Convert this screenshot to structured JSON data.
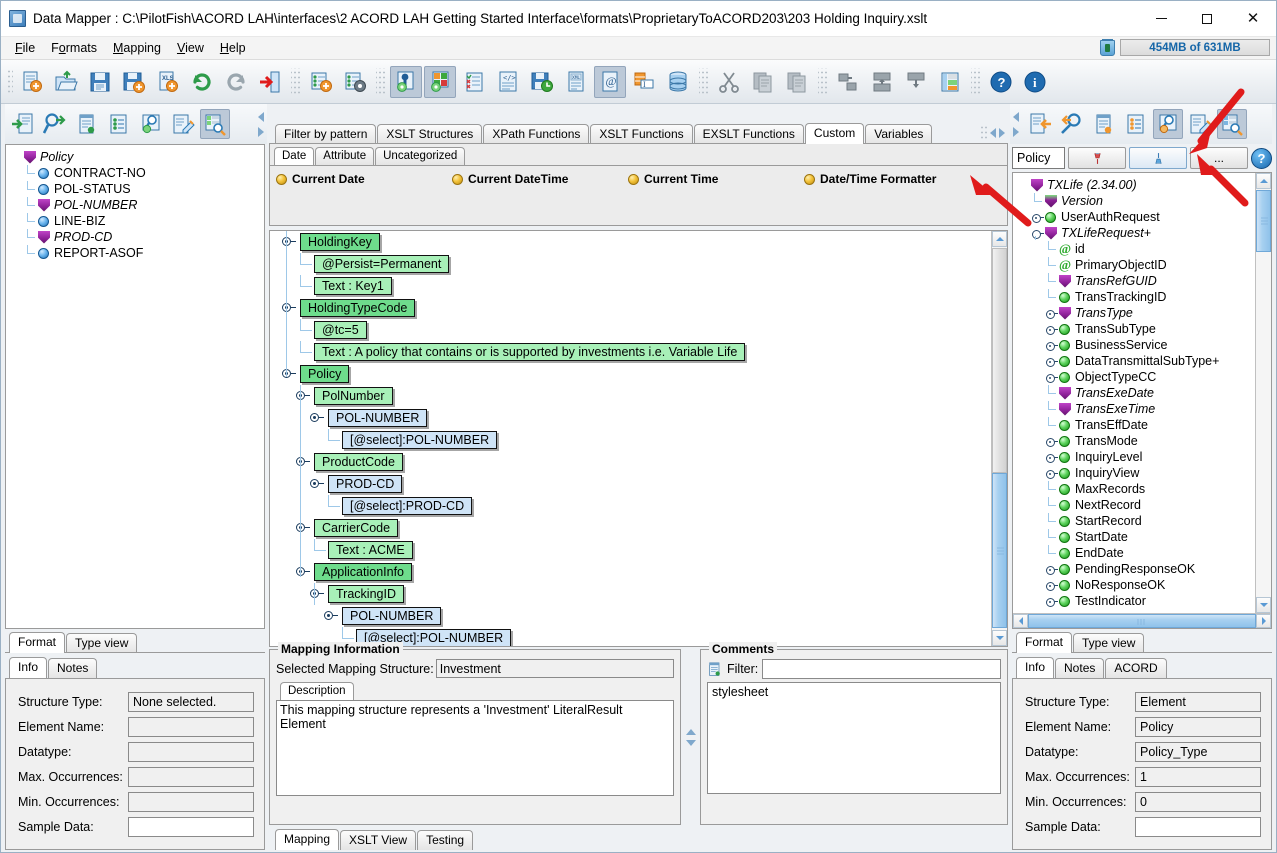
{
  "window": {
    "title": "Data Mapper : C:\\PilotFish\\ACORD LAH\\interfaces\\2 ACORD LAH Getting Started Interface\\formats\\ProprietaryToACORD203\\203 Holding Inquiry.xslt",
    "minimize": "–",
    "maximize": "□",
    "close": "✕"
  },
  "menu": {
    "items": [
      "File",
      "Formats",
      "Mapping",
      "View",
      "Help"
    ],
    "memory": "454MB of 631MB"
  },
  "toolbar": {
    "groups": [
      {
        "buttons": [
          {
            "name": "new-mapping-icon",
            "label": "New"
          },
          {
            "name": "open-folder-icon",
            "label": "Open"
          },
          {
            "name": "save-icon",
            "label": "Save"
          },
          {
            "name": "save-as-icon",
            "label": "Save As"
          },
          {
            "name": "export-xls-icon",
            "label": "Export XLS"
          },
          {
            "name": "undo-icon",
            "label": "Undo"
          },
          {
            "name": "redo-icon",
            "label": "Redo"
          },
          {
            "name": "exit-icon",
            "label": "Exit"
          }
        ]
      },
      {
        "buttons": [
          {
            "name": "add-format-icon",
            "label": "Add Format"
          },
          {
            "name": "format-settings-icon",
            "label": "Format Settings"
          }
        ]
      },
      {
        "buttons": [
          {
            "name": "show-info-icon",
            "label": "Show Info",
            "active": true
          },
          {
            "name": "show-colors-icon",
            "label": "Show Colors",
            "active": true
          },
          {
            "name": "validate-icon",
            "label": "Validate"
          },
          {
            "name": "source-view-icon",
            "label": "Source View"
          },
          {
            "name": "save-test-icon",
            "label": "Save Test"
          },
          {
            "name": "xml-doc-icon",
            "label": "XML Document"
          },
          {
            "name": "at-doc-icon",
            "label": "Annotations",
            "active": true
          },
          {
            "name": "table-insert-icon",
            "label": "Insert Table"
          },
          {
            "name": "database-icon",
            "label": "Database"
          }
        ]
      },
      {
        "buttons": [
          {
            "name": "cut-icon",
            "label": "Cut"
          },
          {
            "name": "copy-icon",
            "label": "Copy"
          },
          {
            "name": "paste-icon",
            "label": "Paste"
          }
        ]
      },
      {
        "buttons": [
          {
            "name": "move-left-icon",
            "label": "Move Left"
          },
          {
            "name": "move-up-icon",
            "label": "Move Up"
          },
          {
            "name": "move-down-icon",
            "label": "Move Down"
          },
          {
            "name": "group-icon",
            "label": "Group"
          }
        ]
      },
      {
        "buttons": [
          {
            "name": "help-icon",
            "label": "Help"
          },
          {
            "name": "about-icon",
            "label": "About"
          }
        ]
      }
    ]
  },
  "left_toolbar": {
    "buttons": [
      {
        "name": "import-source-icon",
        "label": "Import Source"
      },
      {
        "name": "find-source-icon",
        "label": "Find Source"
      },
      {
        "name": "notes-source-icon",
        "label": "Source Notes"
      },
      {
        "name": "list-source-icon",
        "label": "Source List"
      },
      {
        "name": "inspect-source-icon",
        "label": "Inspect Source"
      },
      {
        "name": "edit-source-icon",
        "label": "Edit Source"
      },
      {
        "name": "tree-source-icon",
        "label": "Source Tree View",
        "active": true
      }
    ]
  },
  "right_toolbar": {
    "buttons": [
      {
        "name": "import-target-icon",
        "label": "Import Target"
      },
      {
        "name": "find-target-icon",
        "label": "Find Target"
      },
      {
        "name": "notes-target-icon",
        "label": "Target Notes"
      },
      {
        "name": "list-target-icon",
        "label": "Target List"
      },
      {
        "name": "inspect-target-icon",
        "label": "Inspect Target",
        "active": true
      },
      {
        "name": "edit-target-icon",
        "label": "Edit Target"
      },
      {
        "name": "tree-target-icon",
        "label": "Target Tree View",
        "active": true
      }
    ]
  },
  "left_panel": {
    "tree": [
      {
        "label": "Policy",
        "icon": "shield",
        "indent": 0,
        "handle": "root",
        "italic": true
      },
      {
        "label": "CONTRACT-NO",
        "icon": "ball",
        "indent": 1,
        "handle": "leaf",
        "italic": false
      },
      {
        "label": "POL-STATUS",
        "icon": "ball",
        "indent": 1,
        "handle": "leaf",
        "italic": false
      },
      {
        "label": "POL-NUMBER",
        "icon": "shield",
        "indent": 1,
        "handle": "leaf",
        "italic": true
      },
      {
        "label": "LINE-BIZ",
        "icon": "ball",
        "indent": 1,
        "handle": "leaf",
        "italic": false
      },
      {
        "label": "PROD-CD",
        "icon": "shield",
        "indent": 1,
        "handle": "leaf",
        "italic": true
      },
      {
        "label": "REPORT-ASOF",
        "icon": "ball",
        "indent": 1,
        "handle": "leaf-last",
        "italic": false
      }
    ],
    "view_tabs": [
      {
        "label": "Format",
        "selected": true
      },
      {
        "label": "Type view",
        "selected": false
      }
    ],
    "detail_tabs": [
      {
        "label": "Info",
        "selected": true
      },
      {
        "label": "Notes",
        "selected": false
      }
    ],
    "info": [
      {
        "label": "Structure Type:",
        "value": "None selected.",
        "white": false
      },
      {
        "label": "Element Name:",
        "value": "",
        "white": false
      },
      {
        "label": "Datatype:",
        "value": "",
        "white": false
      },
      {
        "label": "Max. Occurrences:",
        "value": "",
        "white": false
      },
      {
        "label": "Min. Occurrences:",
        "value": "",
        "white": false
      },
      {
        "label": "Sample Data:",
        "value": "",
        "white": true
      }
    ]
  },
  "center_panel": {
    "func_tabs": [
      {
        "label": "Filter by pattern",
        "selected": false
      },
      {
        "label": "XSLT Structures",
        "selected": false
      },
      {
        "label": "XPath Functions",
        "selected": false
      },
      {
        "label": "XSLT Functions",
        "selected": false
      },
      {
        "label": "EXSLT Functions",
        "selected": false
      },
      {
        "label": "Custom",
        "selected": true
      },
      {
        "label": "Variables",
        "selected": false
      }
    ],
    "func_subtabs": [
      {
        "label": "Date",
        "selected": true
      },
      {
        "label": "Attribute",
        "selected": false
      },
      {
        "label": "Uncategorized",
        "selected": false
      }
    ],
    "func_items": [
      "Current Date",
      "Current DateTime",
      "Current Time",
      "Date/Time Formatter"
    ],
    "mapping_tree": [
      {
        "label": "HoldingKey",
        "type": "g1",
        "indent": 0,
        "knob": true
      },
      {
        "label": "@Persist=Permanent",
        "type": "g2",
        "indent": 1,
        "knob": false
      },
      {
        "label": "Text : Key1",
        "type": "g2",
        "indent": 1,
        "knob": false
      },
      {
        "label": "HoldingTypeCode",
        "type": "g1",
        "indent": 0,
        "knob": true
      },
      {
        "label": "@tc=5",
        "type": "g2",
        "indent": 1,
        "knob": false
      },
      {
        "label": "Text : A policy that contains or is supported by investments i.e. Variable Life",
        "type": "g2",
        "indent": 1,
        "knob": false
      },
      {
        "label": "Policy",
        "type": "g1",
        "indent": 0,
        "knob": true
      },
      {
        "label": "PolNumber",
        "type": "g2",
        "indent": 1,
        "knob": true
      },
      {
        "label": "POL-NUMBER",
        "type": "b1",
        "indent": 2,
        "knob": true
      },
      {
        "label": "[@select]:POL-NUMBER",
        "type": "b1",
        "indent": 3,
        "knob": false
      },
      {
        "label": "ProductCode",
        "type": "g2",
        "indent": 1,
        "knob": true
      },
      {
        "label": "PROD-CD",
        "type": "b1",
        "indent": 2,
        "knob": true
      },
      {
        "label": "[@select]:PROD-CD",
        "type": "b1",
        "indent": 3,
        "knob": false
      },
      {
        "label": "CarrierCode",
        "type": "g2",
        "indent": 1,
        "knob": true
      },
      {
        "label": "Text : ACME",
        "type": "g2",
        "indent": 2,
        "knob": false
      },
      {
        "label": "ApplicationInfo",
        "type": "g1",
        "indent": 1,
        "knob": true
      },
      {
        "label": "TrackingID",
        "type": "g2",
        "indent": 2,
        "knob": true
      },
      {
        "label": "POL-NUMBER",
        "type": "b1",
        "indent": 3,
        "knob": true
      },
      {
        "label": "[@select]:POL-NUMBER",
        "type": "b1",
        "indent": 4,
        "knob": false
      }
    ],
    "mapping_info": {
      "group_title": "Mapping Information",
      "selected_label": "Selected Mapping Structure:",
      "selected_value": "Investment",
      "desc_tab": "Description",
      "description": "This mapping structure represents a 'Investment' LiteralResult Element"
    },
    "comments": {
      "group_title": "Comments",
      "filter_label": "Filter:",
      "filter_value": "",
      "body": "stylesheet"
    },
    "bottom_tabs": [
      {
        "label": "Mapping",
        "selected": true
      },
      {
        "label": "XSLT View",
        "selected": false
      },
      {
        "label": "Testing",
        "selected": false
      }
    ]
  },
  "right_panel": {
    "search_value": "Policy",
    "btn_prev": "pin-red-icon",
    "btn_next": "pin-blue-icon",
    "btn_more": "...",
    "btn_help": "?",
    "tree": [
      {
        "label": "TXLife (2.34.00)",
        "icon": "shield",
        "indent": 0,
        "handle": "root",
        "italic": true
      },
      {
        "label": "Version",
        "icon": "shield-green",
        "indent": 1,
        "handle": "leaf",
        "italic": true
      },
      {
        "label": "UserAuthRequest",
        "icon": "ball-green",
        "indent": 1,
        "handle": "plus",
        "italic": false
      },
      {
        "label": "TXLifeRequest+",
        "icon": "shield",
        "indent": 1,
        "handle": "minus",
        "italic": true
      },
      {
        "label": "id",
        "icon": "at",
        "indent": 2,
        "handle": "leaf",
        "italic": false
      },
      {
        "label": "PrimaryObjectID",
        "icon": "at",
        "indent": 2,
        "handle": "leaf",
        "italic": false
      },
      {
        "label": "TransRefGUID",
        "icon": "shield",
        "indent": 2,
        "handle": "leaf",
        "italic": true
      },
      {
        "label": "TransTrackingID",
        "icon": "ball-green",
        "indent": 2,
        "handle": "leaf",
        "italic": false
      },
      {
        "label": "TransType",
        "icon": "shield",
        "indent": 2,
        "handle": "plus",
        "italic": true
      },
      {
        "label": "TransSubType",
        "icon": "ball-green",
        "indent": 2,
        "handle": "plus",
        "italic": false
      },
      {
        "label": "BusinessService",
        "icon": "ball-green",
        "indent": 2,
        "handle": "plus",
        "italic": false
      },
      {
        "label": "DataTransmittalSubType+",
        "icon": "ball-green",
        "indent": 2,
        "handle": "plus",
        "italic": false
      },
      {
        "label": "ObjectTypeCC",
        "icon": "ball-green",
        "indent": 2,
        "handle": "plus",
        "italic": false
      },
      {
        "label": "TransExeDate",
        "icon": "shield",
        "indent": 2,
        "handle": "leaf",
        "italic": true
      },
      {
        "label": "TransExeTime",
        "icon": "shield",
        "indent": 2,
        "handle": "leaf",
        "italic": true
      },
      {
        "label": "TransEffDate",
        "icon": "ball-green",
        "indent": 2,
        "handle": "leaf",
        "italic": false
      },
      {
        "label": "TransMode",
        "icon": "ball-green",
        "indent": 2,
        "handle": "plus",
        "italic": false
      },
      {
        "label": "InquiryLevel",
        "icon": "ball-green",
        "indent": 2,
        "handle": "plus",
        "italic": false
      },
      {
        "label": "InquiryView",
        "icon": "ball-green",
        "indent": 2,
        "handle": "plus",
        "italic": false
      },
      {
        "label": "MaxRecords",
        "icon": "ball-green",
        "indent": 2,
        "handle": "leaf",
        "italic": false
      },
      {
        "label": "NextRecord",
        "icon": "ball-green",
        "indent": 2,
        "handle": "leaf",
        "italic": false
      },
      {
        "label": "StartRecord",
        "icon": "ball-green",
        "indent": 2,
        "handle": "leaf",
        "italic": false
      },
      {
        "label": "StartDate",
        "icon": "ball-green",
        "indent": 2,
        "handle": "leaf",
        "italic": false
      },
      {
        "label": "EndDate",
        "icon": "ball-green",
        "indent": 2,
        "handle": "leaf",
        "italic": false
      },
      {
        "label": "PendingResponseOK",
        "icon": "ball-green",
        "indent": 2,
        "handle": "plus",
        "italic": false
      },
      {
        "label": "NoResponseOK",
        "icon": "ball-green",
        "indent": 2,
        "handle": "plus",
        "italic": false
      },
      {
        "label": "TestIndicator",
        "icon": "ball-green",
        "indent": 2,
        "handle": "plus",
        "italic": false
      }
    ],
    "view_tabs": [
      {
        "label": "Format",
        "selected": true
      },
      {
        "label": "Type view",
        "selected": false
      }
    ],
    "detail_tabs": [
      {
        "label": "Info",
        "selected": true
      },
      {
        "label": "Notes",
        "selected": false
      },
      {
        "label": "ACORD",
        "selected": false
      }
    ],
    "info": [
      {
        "label": "Structure Type:",
        "value": "Element",
        "white": false
      },
      {
        "label": "Element Name:",
        "value": "Policy",
        "white": false
      },
      {
        "label": "Datatype:",
        "value": "Policy_Type",
        "white": false
      },
      {
        "label": "Max. Occurrences:",
        "value": "1",
        "white": false
      },
      {
        "label": "Min. Occurrences:",
        "value": "0",
        "white": false
      },
      {
        "label": "Sample Data:",
        "value": "",
        "white": true
      }
    ]
  },
  "colors": {
    "accent_blue": "#1566a8",
    "tree_green_dark": "#6edc8c",
    "tree_green_light": "#a8f0b8",
    "tree_blue": "#cfe4f7",
    "annotation_red": "#e01b1b"
  }
}
